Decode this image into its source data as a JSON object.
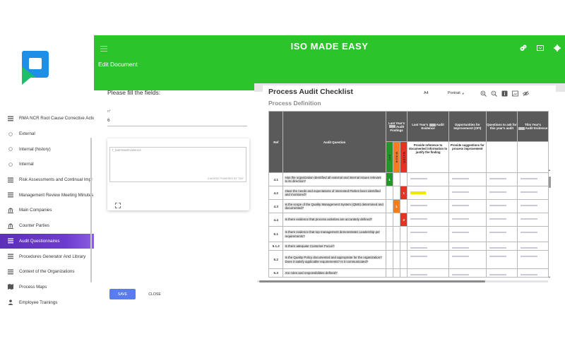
{
  "header": {
    "app_title": "ISO MADE EASY",
    "subtitle": "Edit Document"
  },
  "sidebar": {
    "items": [
      {
        "label": "RMA NCR Root Cause Corrective Actio",
        "icon": "list-icon"
      },
      {
        "label": "External",
        "icon": "circle-icon"
      },
      {
        "label": "Internal (history)",
        "icon": "circle-icon"
      },
      {
        "label": "Internal",
        "icon": "circle-icon"
      },
      {
        "label": "Risk Assessments and Continual Impr",
        "icon": "list-icon"
      },
      {
        "label": "Management Review Meeting Minutes",
        "icon": "list-icon"
      },
      {
        "label": "Main Companies",
        "icon": "bank-icon"
      },
      {
        "label": "Counter Parties",
        "icon": "bank-icon"
      },
      {
        "label": "Audit Questionnaires",
        "icon": "list-icon",
        "active": true
      },
      {
        "label": "Procedures Generator And Library",
        "icon": "list-icon"
      },
      {
        "label": "Context of the Organizations",
        "icon": "list-icon"
      },
      {
        "label": "Process Maps",
        "icon": "map-icon"
      },
      {
        "label": "Employee Trainings",
        "icon": "person-icon"
      }
    ]
  },
  "form": {
    "title": "Please fill the fields:",
    "field_label": "n°",
    "field_value": "6",
    "editor_placeholder": "f_lastYearEvidence",
    "editor_footer": "0 WORDS   POWERED BY TINY",
    "save_label": "SAVE",
    "close_label": "CLOSE"
  },
  "doc": {
    "title": "Process Audit Checklist",
    "subtitle": "Process Definition",
    "toolbar": {
      "page_size": "A4",
      "orientation": "Portrait"
    },
    "table": {
      "headers": {
        "ref": "Ref",
        "question": "Audit Question",
        "findings": "Last Year's  Audit Findings",
        "findings_pre": "Last Year's",
        "findings_post": "Audit Findings",
        "evidence_pre": "Last Year's",
        "evidence_post": "Audit Evidence",
        "improvement": "Opportunities for Improvement (OFI)",
        "questions": "Questions to ask for this year's audit",
        "this_year_pre": "This Year's",
        "this_year_post": "Audit Evidence"
      },
      "finding_cols": [
        "OFI",
        "MINOR",
        "MAJOR"
      ],
      "finding_col_labels": [
        "O F I",
        "M I N O R",
        "M A J O R"
      ],
      "subheaders": {
        "evidence": "Provide reference to documented information to justify the finding",
        "improvement": "Provide suggestions for process improvement"
      },
      "rows": [
        {
          "ref": "4.1",
          "question": "Has the organization identified all external and internal issues relevant to its direction?",
          "ofi": "1",
          "minor": "",
          "major": "",
          "yellow": false
        },
        {
          "ref": "4.2",
          "question": "Have the needs and expectations of interested Parties been identified and monitored?",
          "ofi": "",
          "minor": "",
          "major": "1",
          "yellow": true
        },
        {
          "ref": "4.3",
          "question": "Is the scope of the Quality Management System (QMS) determined and documented?",
          "ofi": "",
          "minor": "1",
          "major": "",
          "yellow": false
        },
        {
          "ref": "4.4",
          "question": "Is there evidence that process activities are accurately defined?",
          "ofi": "",
          "minor": "",
          "major": "2",
          "yellow": false
        },
        {
          "ref": "5.1",
          "question": "Is there evidence that top management demonstrates Leadership per requirements?",
          "ofi": "",
          "minor": "",
          "major": "",
          "yellow": false
        },
        {
          "ref": "5.1.2",
          "question": "Is there adequate Customer Focus?",
          "ofi": "",
          "minor": "",
          "major": "",
          "yellow": false
        },
        {
          "ref": "5.2",
          "question": "Is the Quality Policy documented and appropriate for the organization? Does it satisfy applicable requirements? Is it communicated?",
          "ofi": "",
          "minor": "",
          "major": "",
          "yellow": false
        },
        {
          "ref": "5.3",
          "question": "Are roles and responsibilities defined?",
          "ofi": "",
          "minor": "",
          "major": "",
          "yellow": false
        }
      ]
    }
  },
  "colors": {
    "header_green": "#2bc42b",
    "active_purple": "#5b2fb8",
    "save_blue": "#5b7cf0",
    "ofi_green": "#1f9a2a",
    "minor_orange": "#f57c1f",
    "major_red": "#e53223",
    "finding_yellow": "#f3e600"
  }
}
